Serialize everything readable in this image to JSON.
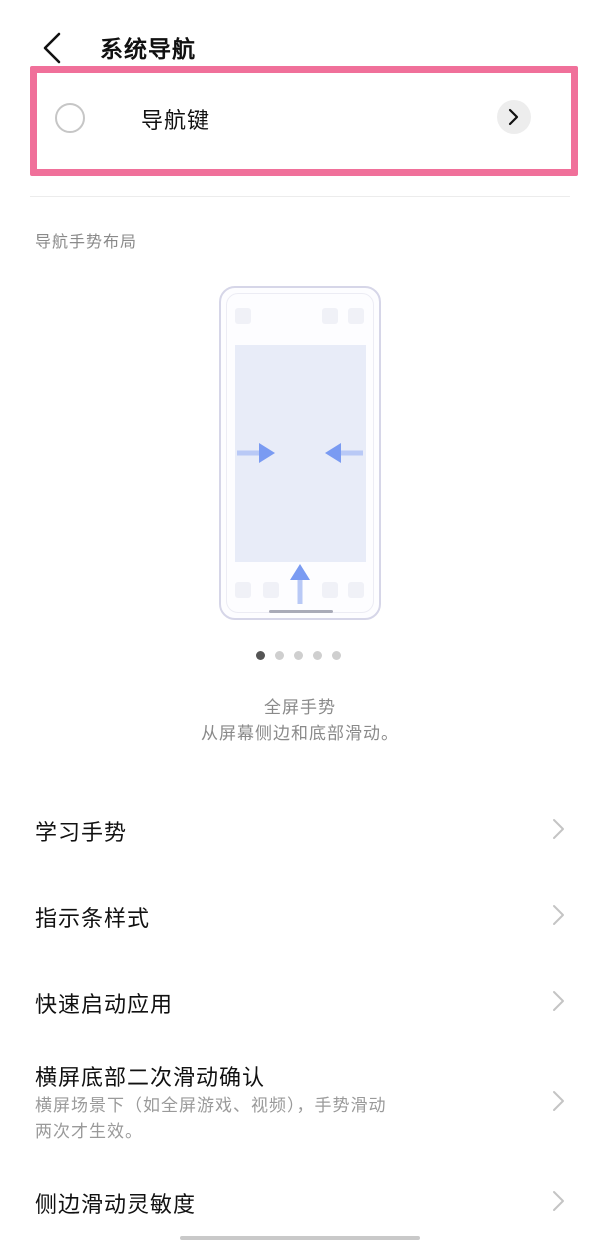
{
  "header": {
    "title": "系统导航",
    "back_icon": "chevron-left-icon"
  },
  "nav_option": {
    "label": "导航键",
    "selected": false,
    "detail_icon": "chevron-right-icon",
    "highlight_color": "#f0709a"
  },
  "section": {
    "label": "导航手势布局"
  },
  "gesture_preview": {
    "page_count": 5,
    "active_page": 1,
    "title": "全屏手势",
    "description": "从屏幕侧边和底部滑动。",
    "arrow_color": "#7a9bf2"
  },
  "menu": [
    {
      "label": "学习手势",
      "subtitle": ""
    },
    {
      "label": "指示条样式",
      "subtitle": ""
    },
    {
      "label": "快速启动应用",
      "subtitle": ""
    },
    {
      "label": "横屏底部二次滑动确认",
      "subtitle_line1": "横屏场景下（如全屏游戏、视频），手势滑动",
      "subtitle_line2": "两次才生效。"
    },
    {
      "label": "侧边滑动灵敏度",
      "subtitle": ""
    }
  ]
}
